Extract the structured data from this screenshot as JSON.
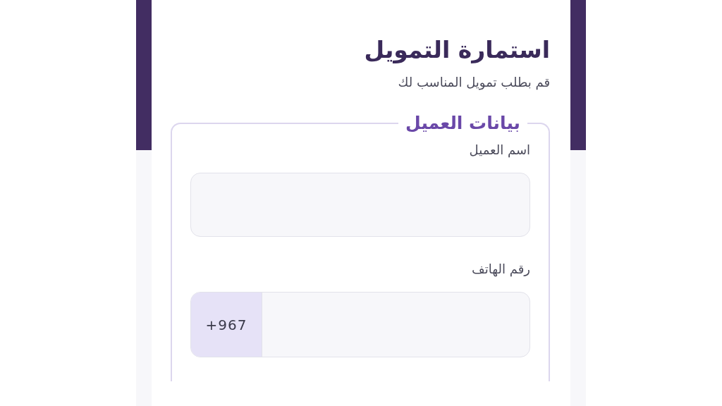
{
  "form": {
    "title": "استمارة التمويل",
    "subtitle": "قم بطلب تمويل المناسب لك"
  },
  "section": {
    "legend": "بيانات العميل",
    "fields": [
      {
        "kind": "text",
        "label": "اسم العميل"
      },
      {
        "kind": "phone",
        "label": "رقم الهاتف",
        "prefix": "+967"
      }
    ]
  }
}
